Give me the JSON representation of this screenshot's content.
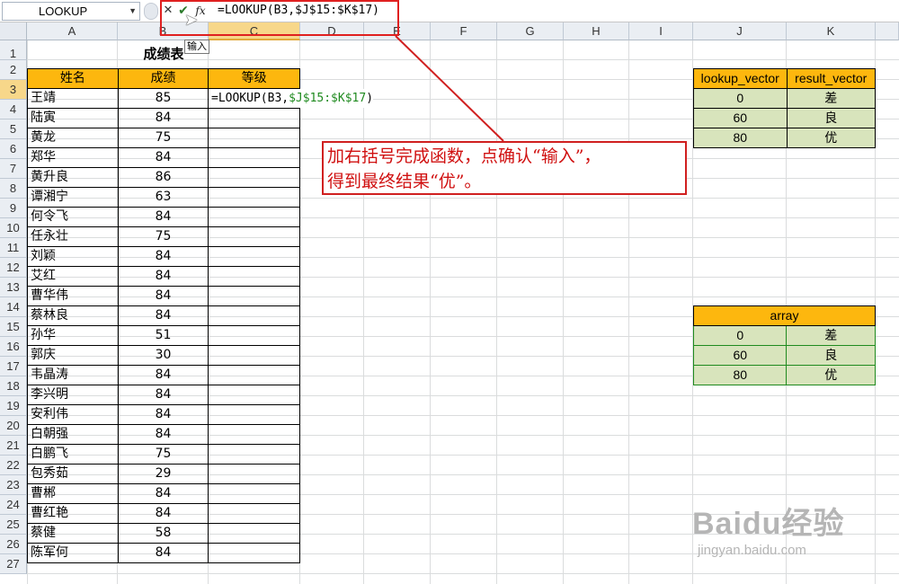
{
  "formula_bar": {
    "name_box": "LOOKUP",
    "cancel_icon": "close-icon",
    "enter_icon": "check-icon",
    "fx_label": "fx",
    "formula": "=LOOKUP(B3,$J$15:$K$17)",
    "tooltip": "输入"
  },
  "columns": [
    "A",
    "B",
    "C",
    "D",
    "E",
    "F",
    "G",
    "H",
    "I",
    "J",
    "K"
  ],
  "rows": [
    "1",
    "2",
    "3",
    "4",
    "5",
    "6",
    "7",
    "8",
    "9",
    "10",
    "11",
    "12",
    "13",
    "14",
    "15",
    "16",
    "17",
    "18",
    "19",
    "20",
    "21",
    "22",
    "23",
    "24",
    "25",
    "26",
    "27"
  ],
  "sheet": {
    "title": "成绩表",
    "headers": {
      "name": "姓名",
      "score": "成绩",
      "grade": "等级"
    },
    "editing_cell": {
      "ref": "C3",
      "prefix": "=LOOKUP(B3,",
      "range": "$J$15:$K$17",
      "suffix": ")"
    },
    "students": [
      {
        "name": "王靖",
        "score": "85"
      },
      {
        "name": "陆寅",
        "score": "84"
      },
      {
        "name": "黄龙",
        "score": "75"
      },
      {
        "name": "郑华",
        "score": "84"
      },
      {
        "name": "黄升良",
        "score": "86"
      },
      {
        "name": "谭湘宁",
        "score": "63"
      },
      {
        "name": "何令飞",
        "score": "84"
      },
      {
        "name": "任永壮",
        "score": "75"
      },
      {
        "name": "刘颖",
        "score": "84"
      },
      {
        "name": "艾红",
        "score": "84"
      },
      {
        "name": "曹华伟",
        "score": "84"
      },
      {
        "name": "蔡林良",
        "score": "84"
      },
      {
        "name": "孙华",
        "score": "51"
      },
      {
        "name": "郭庆",
        "score": "30"
      },
      {
        "name": "韦晶涛",
        "score": "84"
      },
      {
        "name": "李兴明",
        "score": "84"
      },
      {
        "name": "安利伟",
        "score": "84"
      },
      {
        "name": "白朝强",
        "score": "84"
      },
      {
        "name": "白鹏飞",
        "score": "75"
      },
      {
        "name": "包秀茹",
        "score": "29"
      },
      {
        "name": "曹郴",
        "score": "84"
      },
      {
        "name": "曹红艳",
        "score": "84"
      },
      {
        "name": "蔡健",
        "score": "58"
      },
      {
        "name": "陈军何",
        "score": "84"
      }
    ]
  },
  "lookup_table": {
    "headers": [
      "lookup_vector",
      "result_vector"
    ],
    "rows": [
      [
        "0",
        "差"
      ],
      [
        "60",
        "良"
      ],
      [
        "80",
        "优"
      ]
    ]
  },
  "array_table": {
    "header": "array",
    "rows": [
      [
        "0",
        "差"
      ],
      [
        "60",
        "良"
      ],
      [
        "80",
        "优"
      ]
    ]
  },
  "callout": {
    "line1": "加右括号完成函数，点确认“输入”，",
    "line2": "得到最终结果“优”。"
  },
  "watermark": {
    "brand": "Baidu经验",
    "url": "jingyan.baidu.com"
  },
  "colors": {
    "header_orange": "#fdb70e",
    "table_green": "#d8e4bc",
    "callout_red": "#d02020",
    "range_green": "#1f8a1f"
  }
}
